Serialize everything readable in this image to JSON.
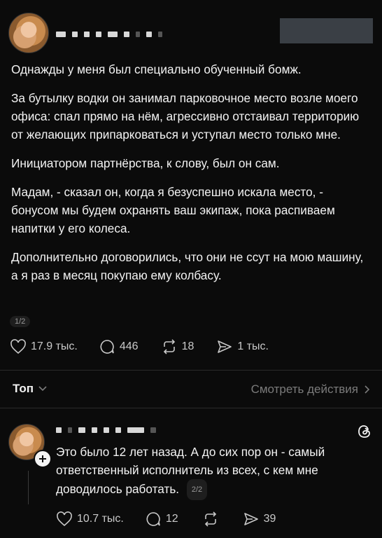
{
  "post": {
    "paragraphs": [
      "Однажды у меня был специально обученный бомж.",
      "За бутылку водки он занимал парковочное место возле моего офиса: спал прямо на нём, агрессивно отстаивал территорию от желающих припарковаться и уступал место только мне.",
      "Инициатором партнёрства, к слову, был он сам.",
      "Мадам, - сказал он, когда я безуспешно искала место, - бонусом мы будем охранять ваш экипаж, пока распиваем напитки у его колеса.",
      "Дополнительно договорились, что они не ссут на мою машину, а я раз в месяц покупаю ему колбасу."
    ],
    "counter": "1/2",
    "likes": "17.9 тыс.",
    "comments": "446",
    "reposts": "18",
    "shares": "1 тыс."
  },
  "sort_bar": {
    "label": "Топ",
    "activity_link": "Смотреть действия"
  },
  "reply": {
    "text": "Это было 12 лет назад. А до сих пор он - самый ответственный исполнитель из всех, с кем мне доводилось работать.",
    "counter": "2/2",
    "likes": "10.7 тыс.",
    "comments": "12",
    "reposts": "",
    "shares": "39"
  },
  "colors": {
    "background": "#0b0b0b",
    "text": "#f3f3f3",
    "muted": "#7b7b7b"
  },
  "icons": [
    "heart-icon",
    "comment-icon",
    "repost-icon",
    "share-icon",
    "chevron-down-icon",
    "chevron-right-icon",
    "threads-logo-icon",
    "plus-icon"
  ]
}
